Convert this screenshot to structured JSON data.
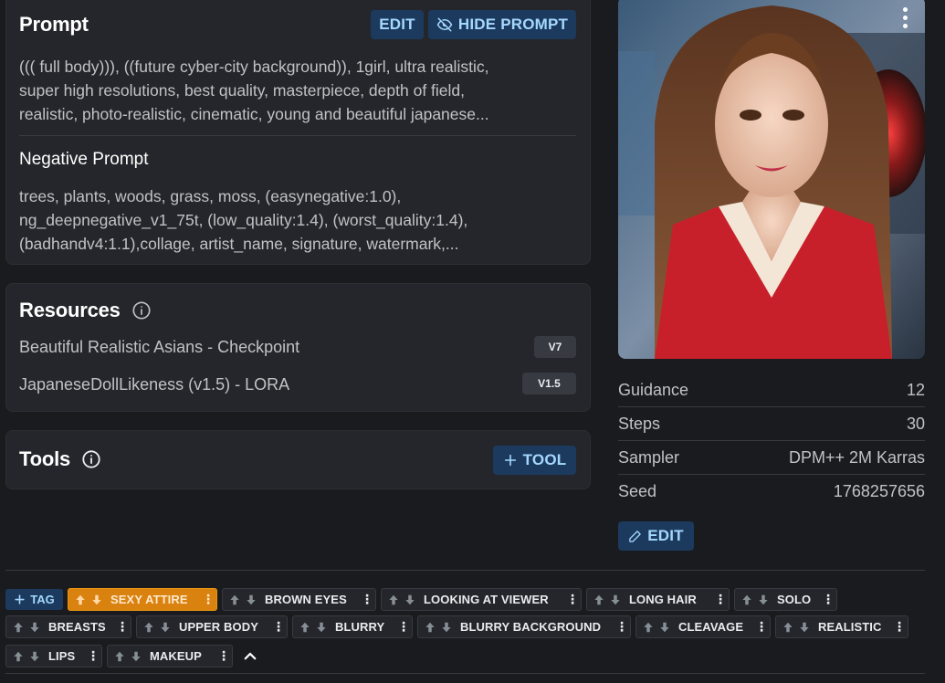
{
  "prompt": {
    "title": "Prompt",
    "edit_label": "EDIT",
    "hide_label": "HIDE PROMPT",
    "text_lines": [
      "((( full body))), ((future cyber-city background)), 1girl, ultra realistic,",
      "super high resolutions, best quality, masterpiece, depth of field,",
      "realistic, photo-realistic, cinematic, young and beautiful japanese..."
    ],
    "negative_title": "Negative Prompt",
    "negative_lines": [
      "trees, plants, woods, grass, moss, (easynegative:1.0),",
      "ng_deepnegative_v1_75t, (low_quality:1.4), (worst_quality:1.4),",
      "(badhandv4:1.1),collage, artist_name, signature, watermark,..."
    ]
  },
  "resources": {
    "title": "Resources",
    "items": [
      {
        "name": "Beautiful Realistic Asians - Checkpoint",
        "version": "V7"
      },
      {
        "name": "JapaneseDollLikeness (v1.5) - LORA",
        "version": "V1.5"
      }
    ]
  },
  "tools": {
    "title": "Tools",
    "add_label": "TOOL"
  },
  "stats": [
    {
      "label": "Guidance",
      "value": "12"
    },
    {
      "label": "Steps",
      "value": "30"
    },
    {
      "label": "Sampler",
      "value": "DPM++ 2M Karras"
    },
    {
      "label": "Seed",
      "value": "1768257656"
    }
  ],
  "stats_edit_label": "EDIT",
  "tags": {
    "add_label": "TAG",
    "items": [
      "SEXY ATTIRE",
      "BROWN EYES",
      "LOOKING AT VIEWER",
      "LONG HAIR",
      "SOLO",
      "BREASTS",
      "UPPER BODY",
      "BLURRY",
      "BLURRY BACKGROUND",
      "CLEAVAGE",
      "REALISTIC",
      "LIPS",
      "MAKEUP"
    ]
  },
  "colors": {
    "accent": "#a5d8ff",
    "button_bg": "#1c3a5e",
    "highlight_tag": "#d9820f"
  }
}
